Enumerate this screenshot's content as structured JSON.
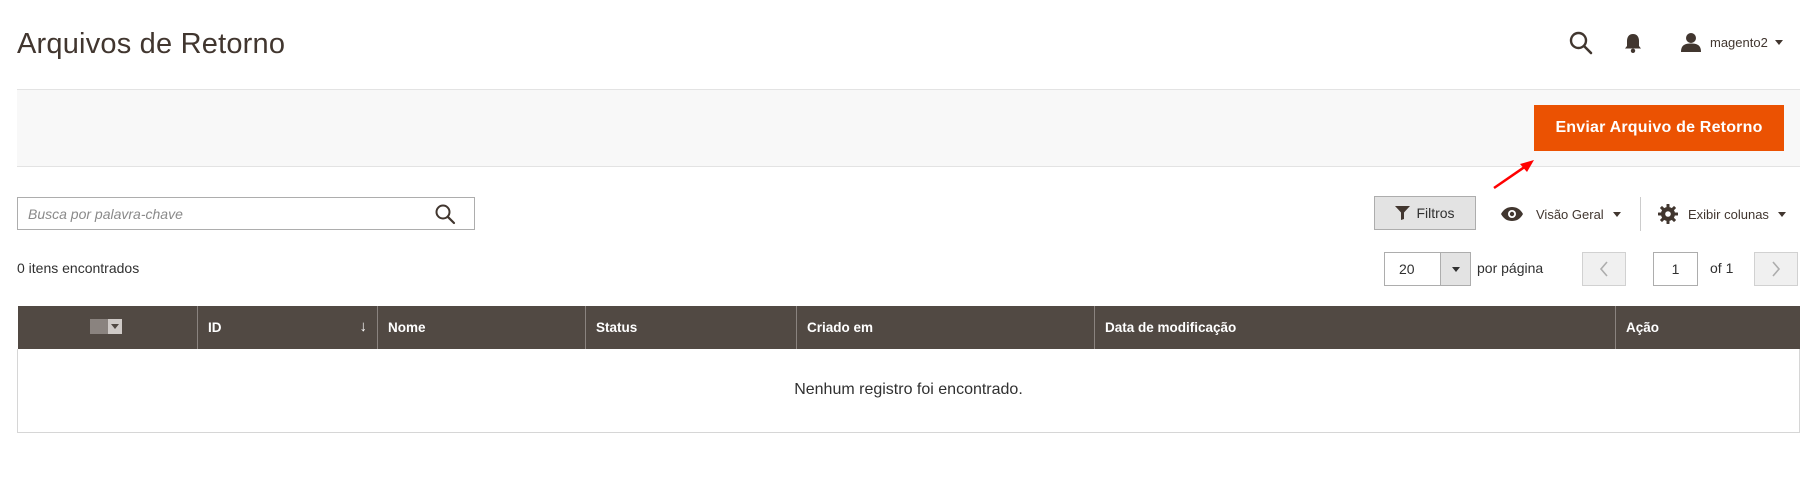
{
  "page": {
    "title": "Arquivos de Retorno"
  },
  "header": {
    "username": "magento2"
  },
  "actions": {
    "primary_label": "Enviar Arquivo de Retorno"
  },
  "search": {
    "placeholder": "Busca por palavra-chave"
  },
  "toolbar": {
    "filters_label": "Filtros",
    "view_label": "Visão Geral",
    "columns_label": "Exibir colunas"
  },
  "grid": {
    "records_found": "0 itens encontrados",
    "per_page_value": "20",
    "per_page_label": "por página",
    "current_page": "1",
    "total_pages_label": "of 1",
    "columns": [
      "ID",
      "Nome",
      "Status",
      "Criado em",
      "Data de modificação",
      "Ação"
    ],
    "sort_indicator": "↓",
    "empty_message": "Nenhum registro foi encontrado."
  },
  "colors": {
    "accent": "#eb5202",
    "header_bg": "#514943",
    "annotation": "#ff0000"
  },
  "icons": [
    "search-icon",
    "bell-icon",
    "user-icon",
    "filter-icon",
    "eye-icon",
    "gear-icon",
    "chevron-left-icon",
    "chevron-right-icon",
    "annotation-arrow"
  ]
}
